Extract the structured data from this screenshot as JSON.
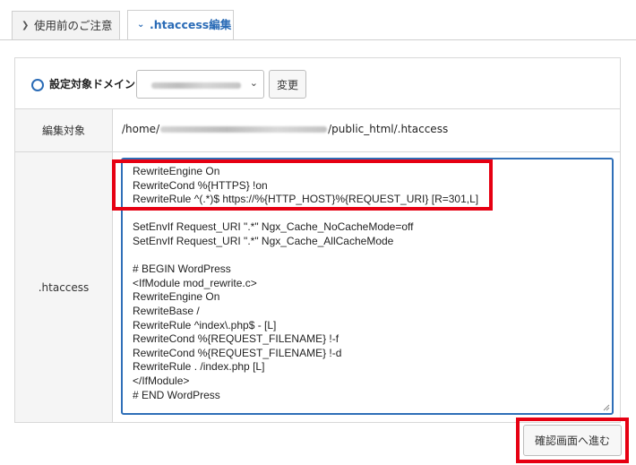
{
  "tabs": [
    {
      "label": "使用前のご注意",
      "icon": "chevron-right-icon",
      "active": false
    },
    {
      "label": ".htaccess編集",
      "icon": "chevron-down-icon",
      "active": true
    }
  ],
  "domain_row": {
    "label": "設定対象ドメイン",
    "change_button": "変更"
  },
  "target_row": {
    "label": "編集対象",
    "path_prefix": "/home/",
    "path_suffix": "/public_html/.htaccess"
  },
  "htaccess_row": {
    "label": ".htaccess",
    "content": "RewriteEngine On\nRewriteCond %{HTTPS} !on\nRewriteRule ^(.*)$ https://%{HTTP_HOST}%{REQUEST_URI} [R=301,L]\n\nSetEnvIf Request_URI \".*\" Ngx_Cache_NoCacheMode=off\nSetEnvIf Request_URI \".*\" Ngx_Cache_AllCacheMode\n\n# BEGIN WordPress\n<IfModule mod_rewrite.c>\nRewriteEngine On\nRewriteBase /\nRewriteRule ^index\\.php$ - [L]\nRewriteCond %{REQUEST_FILENAME} !-f\nRewriteCond %{REQUEST_FILENAME} !-d\nRewriteRule . /index.php [L]\n</IfModule>\n# END WordPress"
  },
  "confirm_button": "確認画面へ進む",
  "colors": {
    "accent": "#2a6bb6",
    "highlight": "#e60012"
  }
}
